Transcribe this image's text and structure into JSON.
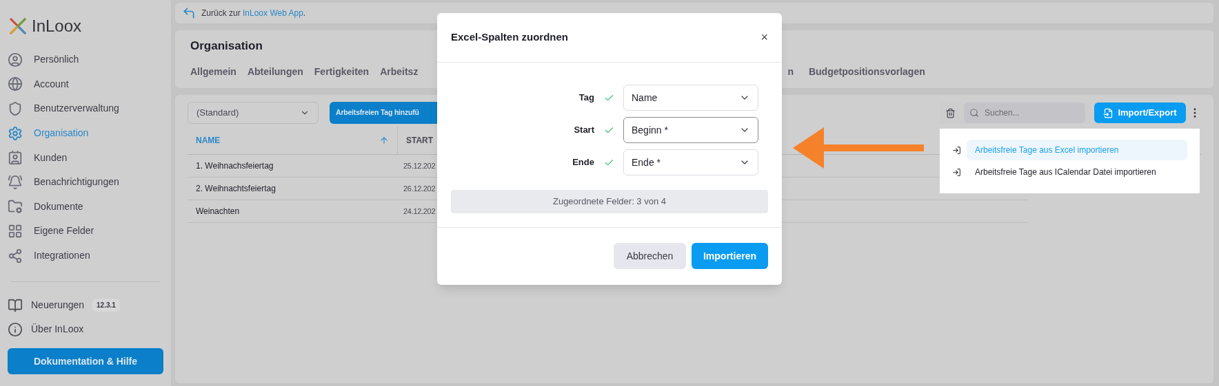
{
  "sidebar": {
    "logo": "InLoox",
    "items": [
      {
        "label": "Persönlich",
        "selected": false
      },
      {
        "label": "Account",
        "selected": false
      },
      {
        "label": "Benutzerverwaltung",
        "selected": false
      },
      {
        "label": "Organisation",
        "selected": true
      },
      {
        "label": "Kunden",
        "selected": false
      },
      {
        "label": "Benachrichtigungen",
        "selected": false
      },
      {
        "label": "Dokumente",
        "selected": false
      },
      {
        "label": "Eigene Felder",
        "selected": false
      },
      {
        "label": "Integrationen",
        "selected": false
      }
    ],
    "bottom_items": [
      {
        "label": "Neuerungen",
        "badge": "12.3.1"
      },
      {
        "label": "Über InLoox"
      }
    ],
    "help_button": "Dokumentation & Hilfe"
  },
  "back_bar": {
    "text": "Zurück zur ",
    "link": "InLoox Web App",
    "suffix": "."
  },
  "header": {
    "title": "Organisation",
    "tabs": [
      {
        "label": "Allgemein"
      },
      {
        "label": "Abteilungen"
      },
      {
        "label": "Fertigkeiten"
      },
      {
        "label": "Arbeitsz"
      },
      {
        "label": "n"
      },
      {
        "label": "Budgetpositionsvorlagen"
      }
    ]
  },
  "toolbar": {
    "calendar_select": "(Standard)",
    "add_button": "Arbeitsfreien Tag hinzufü",
    "search": {
      "placeholder": "Suchen..."
    },
    "import_button": "Import/Export"
  },
  "table": {
    "columns": [
      {
        "label": "NAME",
        "sorted": true
      },
      {
        "label": "START",
        "sorted": false
      }
    ],
    "rows": [
      [
        "1. Weihnachsfeiertag",
        "25.12.202"
      ],
      [
        "2. Weihnachtsfeiertag",
        "26.12.202"
      ],
      [
        "Weinachten",
        "24.12.202"
      ]
    ]
  },
  "import_menu": {
    "items": [
      {
        "label": "Arbeitsfreie Tage aus Excel importieren",
        "selected": true
      },
      {
        "label": "Arbeitsfreie Tage aus ICalendar Datei importieren",
        "selected": false
      }
    ]
  },
  "dialog": {
    "title": "Excel-Spalten zuordnen",
    "close": "×",
    "mappings": [
      {
        "label": "Tag",
        "value": "Name",
        "focused": false
      },
      {
        "label": "Start",
        "value": "Beginn *",
        "focused": true
      },
      {
        "label": "Ende",
        "value": "Ende *",
        "focused": false
      }
    ],
    "summary": "Zugeordnete Felder: 3 von 4",
    "cancel": "Abbrechen",
    "confirm": "Importieren"
  }
}
